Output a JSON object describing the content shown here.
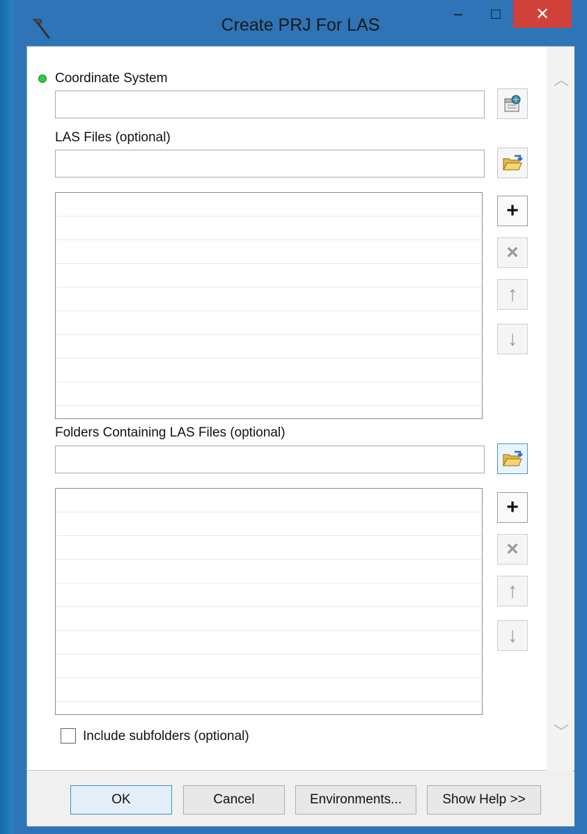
{
  "window": {
    "title": "Create PRJ For LAS",
    "minimize_glyph": "–",
    "maximize_glyph": "□",
    "close_glyph": "✕"
  },
  "params": {
    "coordinate_system": {
      "label": "Coordinate System",
      "value": ""
    },
    "las_files": {
      "label": "LAS Files (optional)",
      "value": "",
      "rows": 9
    },
    "folders": {
      "label": "Folders Containing LAS Files (optional)",
      "value": "",
      "rows": 9
    },
    "include_subfolders": {
      "label": "Include subfolders (optional)",
      "checked": false
    }
  },
  "list_buttons": {
    "add": "+",
    "remove": "×",
    "up": "↑",
    "down": "↓"
  },
  "footer": {
    "ok": "OK",
    "cancel": "Cancel",
    "environments": "Environments...",
    "show_help": "Show Help >>"
  },
  "icons": {
    "app": "hammer-icon",
    "coord_picker": "spatial-reference-icon",
    "browse": "open-folder-icon",
    "scroll_up": "chevron-up-icon",
    "scroll_down": "chevron-down-icon"
  },
  "colors": {
    "title_bar": "#2f74b6",
    "close_button": "#d0413a",
    "required_dot": "#2ecc40"
  }
}
